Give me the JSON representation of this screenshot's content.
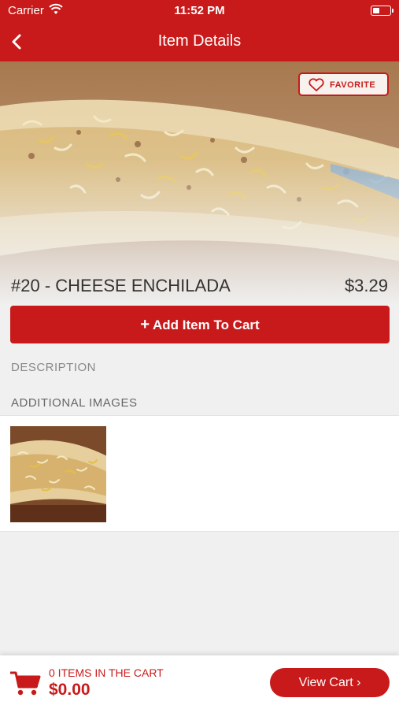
{
  "status_bar": {
    "carrier": "Carrier",
    "time": "11:52 PM"
  },
  "nav": {
    "title": "Item Details"
  },
  "hero": {
    "favorite_label": "FAVORITE"
  },
  "item": {
    "name": "#20 - CHEESE ENCHILADA",
    "price": "$3.29"
  },
  "actions": {
    "add_to_cart_plus": "+",
    "add_to_cart_label": "Add Item To Cart"
  },
  "sections": {
    "description_label": "DESCRIPTION",
    "additional_images_label": "ADDITIONAL IMAGES"
  },
  "cart": {
    "count_text": "0 ITEMS IN THE CART",
    "total": "$0.00",
    "view_cart_label": "View Cart ›"
  },
  "colors": {
    "brand_red": "#c81a1a",
    "background": "#f0f0f0"
  },
  "icons": [
    "wifi-icon",
    "battery-icon",
    "back-chevron-icon",
    "heart-icon",
    "cart-icon"
  ]
}
